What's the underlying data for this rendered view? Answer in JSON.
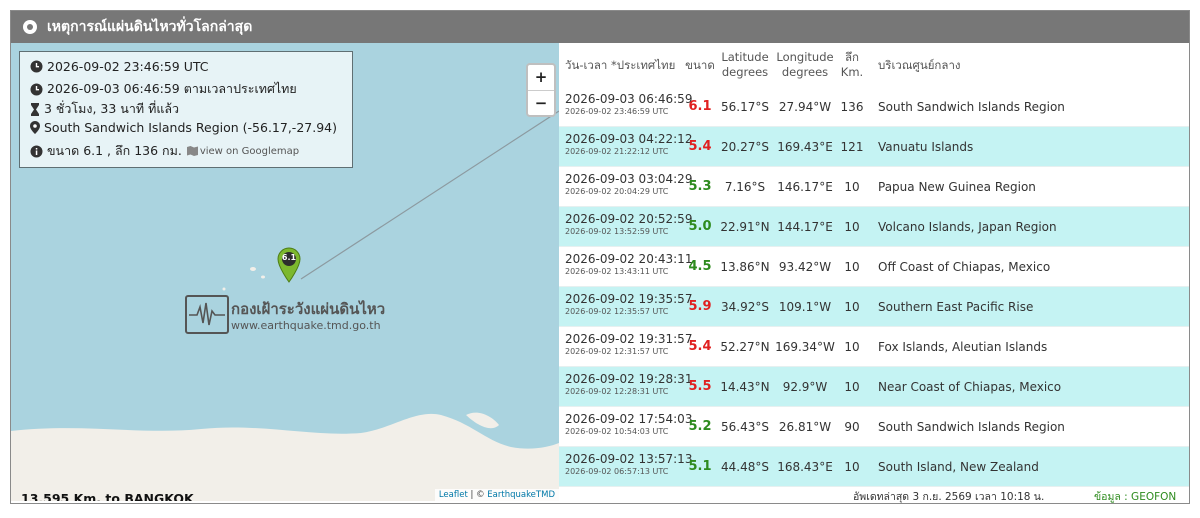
{
  "header": {
    "title": "เหตุการณ์แผ่นดินไหวทั่วโลกล่าสุด"
  },
  "map": {
    "info": {
      "utc_time": "2026-09-02 23:46:59 UTC",
      "thai_time": "2026-09-03 06:46:59 ตามเวลาประเทศไทย",
      "elapsed": "3 ชั่วโมง, 33 นาที ที่แล้ว",
      "location": "South Sandwich Islands Region (-56.17,-27.94)",
      "magnitude_depth": "ขนาด 6.1 , ลึก 136 กม.",
      "googlemap_link": "view on Googlemap"
    },
    "zoom_in": "+",
    "zoom_out": "−",
    "marker_label": "6.1",
    "watermark_title": "กองเฝ้าระวังแผ่นดินไหว",
    "watermark_url": "www.earthquake.tmd.go.th",
    "distance": "13,595 Km. to BANGKOK",
    "attribution_leaflet": "Leaflet",
    "attribution_sep": " | © ",
    "attribution_owner": "EarthquakeTMD"
  },
  "table": {
    "headers": {
      "datetime": "วัน-เวลา *ประเทศไทย",
      "magnitude": "ขนาด",
      "latitude": "Latitude degrees",
      "longitude": "Longitude degrees",
      "depth": "ลึก Km.",
      "region": "บริเวณศูนย์กลาง"
    },
    "rows": [
      {
        "local": "2026-09-03 06:46:59",
        "utc": "2026-09-02 23:46:59 UTC",
        "mag": "6.1",
        "lat": "56.17°S",
        "lon": "27.94°W",
        "depth": "136",
        "region": "South Sandwich Islands Region"
      },
      {
        "local": "2026-09-03 04:22:12",
        "utc": "2026-09-02 21:22:12 UTC",
        "mag": "5.4",
        "lat": "20.27°S",
        "lon": "169.43°E",
        "depth": "121",
        "region": "Vanuatu Islands"
      },
      {
        "local": "2026-09-03 03:04:29",
        "utc": "2026-09-02 20:04:29 UTC",
        "mag": "5.3",
        "lat": "7.16°S",
        "lon": "146.17°E",
        "depth": "10",
        "region": "Papua New Guinea Region"
      },
      {
        "local": "2026-09-02 20:52:59",
        "utc": "2026-09-02 13:52:59 UTC",
        "mag": "5.0",
        "lat": "22.91°N",
        "lon": "144.17°E",
        "depth": "10",
        "region": "Volcano Islands, Japan Region"
      },
      {
        "local": "2026-09-02 20:43:11",
        "utc": "2026-09-02 13:43:11 UTC",
        "mag": "4.5",
        "lat": "13.86°N",
        "lon": "93.42°W",
        "depth": "10",
        "region": "Off Coast of Chiapas, Mexico"
      },
      {
        "local": "2026-09-02 19:35:57",
        "utc": "2026-09-02 12:35:57 UTC",
        "mag": "5.9",
        "lat": "34.92°S",
        "lon": "109.1°W",
        "depth": "10",
        "region": "Southern East Pacific Rise"
      },
      {
        "local": "2026-09-02 19:31:57",
        "utc": "2026-09-02 12:31:57 UTC",
        "mag": "5.4",
        "lat": "52.27°N",
        "lon": "169.34°W",
        "depth": "10",
        "region": "Fox Islands, Aleutian Islands"
      },
      {
        "local": "2026-09-02 19:28:31",
        "utc": "2026-09-02 12:28:31 UTC",
        "mag": "5.5",
        "lat": "14.43°N",
        "lon": "92.9°W",
        "depth": "10",
        "region": "Near Coast of Chiapas, Mexico"
      },
      {
        "local": "2026-09-02 17:54:03",
        "utc": "2026-09-02 10:54:03 UTC",
        "mag": "5.2",
        "lat": "56.43°S",
        "lon": "26.81°W",
        "depth": "90",
        "region": "South Sandwich Islands Region"
      },
      {
        "local": "2026-09-02 13:57:13",
        "utc": "2026-09-02 06:57:13 UTC",
        "mag": "5.1",
        "lat": "44.48°S",
        "lon": "168.43°E",
        "depth": "10",
        "region": "South Island, New Zealand"
      }
    ],
    "updated": "อัพเดทล่าสุด 3 ก.ย. 2569 เวลา 10:18 น.",
    "source": "ข้อมูล : GEOFON"
  },
  "colors": {
    "mag_high": "#e02020",
    "mag_low": "#2e8b1e",
    "row_alt": "#c5f3f3",
    "header_bg": "#777777",
    "sea": "#aad3df",
    "marker": "#7cb82e"
  },
  "icons": [
    "clock-icon",
    "hourglass-icon",
    "map-pin-icon",
    "info-icon",
    "map-icon",
    "earthquake-marker-icon",
    "seismograph-icon"
  ]
}
